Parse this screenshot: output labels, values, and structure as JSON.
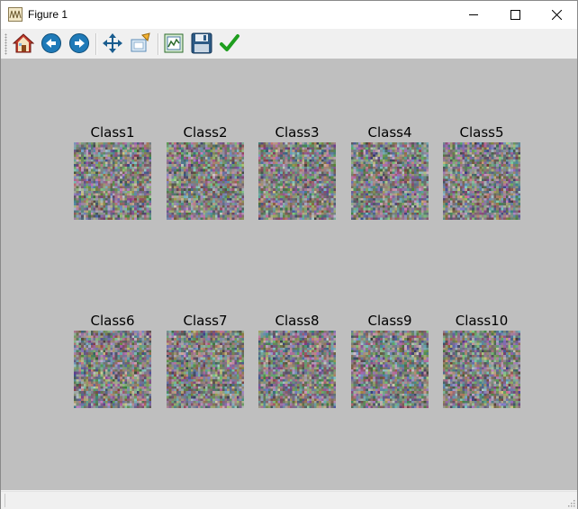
{
  "window": {
    "title": "Figure 1",
    "icon": "matplotlib-figure-icon",
    "controls": [
      "minimize-icon",
      "maximize-icon",
      "close-icon"
    ]
  },
  "toolbar": {
    "buttons": [
      {
        "name": "home-button",
        "icon": "home-icon"
      },
      {
        "name": "back-button",
        "icon": "arrow-left-icon"
      },
      {
        "name": "forward-button",
        "icon": "arrow-right-icon"
      },
      {
        "name": "pan-button",
        "icon": "move-icon"
      },
      {
        "name": "zoom-button",
        "icon": "zoom-rect-icon"
      },
      {
        "name": "subplots-button",
        "icon": "subplots-icon"
      },
      {
        "name": "save-button",
        "icon": "floppy-disk-icon"
      },
      {
        "name": "edit-button",
        "icon": "checkmark-icon"
      }
    ]
  },
  "figure": {
    "background": "#bfbfbf",
    "panels": [
      {
        "title": "Class1"
      },
      {
        "title": "Class2"
      },
      {
        "title": "Class3"
      },
      {
        "title": "Class4"
      },
      {
        "title": "Class5"
      },
      {
        "title": "Class6"
      },
      {
        "title": "Class7"
      },
      {
        "title": "Class8"
      },
      {
        "title": "Class9"
      },
      {
        "title": "Class10"
      }
    ]
  }
}
